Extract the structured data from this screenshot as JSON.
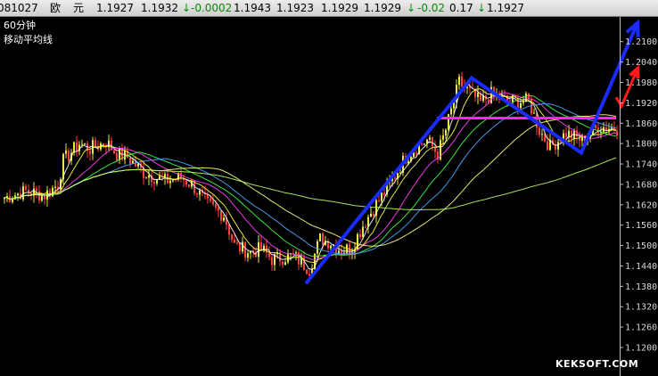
{
  "quote_bar": {
    "code": "081027",
    "name": "欧",
    "name2": "元",
    "price1": "1.1927",
    "price2": "1.1932",
    "change": "-0.0002",
    "open": "1.1943",
    "low": "1.1923",
    "close_a": "1.1929",
    "close_b": "1.1929",
    "change2": "-0.02",
    "value": "0.17",
    "last": "1.1927",
    "arrow_color": "#0a8a0a"
  },
  "chart_data": {
    "type": "line",
    "title": "60分钟",
    "subtitle": "移动平均线",
    "y_ticks": [
      "1.2100",
      "1.2040",
      "1.1980",
      "1.1920",
      "1.1860",
      "1.1800",
      "1.1740",
      "1.1680",
      "1.1620",
      "1.1560",
      "1.1500",
      "1.1440",
      "1.1380",
      "1.1320",
      "1.1260",
      "1.1200"
    ],
    "ylim": [
      1.12,
      1.2115
    ],
    "x_count": 230,
    "anchors": [
      [
        0,
        1.164
      ],
      [
        8,
        1.166
      ],
      [
        15,
        1.1648
      ],
      [
        20,
        1.168
      ],
      [
        22,
        1.175
      ],
      [
        28,
        1.18
      ],
      [
        32,
        1.1785
      ],
      [
        38,
        1.1805
      ],
      [
        42,
        1.177
      ],
      [
        46,
        1.176
      ],
      [
        52,
        1.1715
      ],
      [
        60,
        1.169
      ],
      [
        66,
        1.17
      ],
      [
        70,
        1.168
      ],
      [
        72,
        1.166
      ],
      [
        76,
        1.162
      ],
      [
        82,
        1.159
      ],
      [
        86,
        1.15
      ],
      [
        92,
        1.148
      ],
      [
        96,
        1.149
      ],
      [
        100,
        1.146
      ],
      [
        108,
        1.147
      ],
      [
        114,
        1.143
      ],
      [
        118,
        1.152
      ],
      [
        122,
        1.151
      ],
      [
        126,
        1.1485
      ],
      [
        130,
        1.1495
      ],
      [
        134,
        1.156
      ],
      [
        138,
        1.161
      ],
      [
        144,
        1.168
      ],
      [
        150,
        1.176
      ],
      [
        154,
        1.179
      ],
      [
        158,
        1.181
      ],
      [
        162,
        1.177
      ],
      [
        165,
        1.184
      ],
      [
        170,
        1.198
      ],
      [
        174,
        1.195
      ],
      [
        178,
        1.192
      ],
      [
        182,
        1.1945
      ],
      [
        188,
        1.1925
      ],
      [
        196,
        1.1925
      ],
      [
        200,
        1.184
      ],
      [
        204,
        1.179
      ],
      [
        210,
        1.183
      ],
      [
        216,
        1.181
      ],
      [
        222,
        1.185
      ],
      [
        229,
        1.1845
      ]
    ],
    "ma": [
      {
        "period": 5,
        "color": "#ffffff"
      },
      {
        "period": 10,
        "color": "#ffff40"
      },
      {
        "period": 20,
        "color": "#ff40ff"
      },
      {
        "period": 30,
        "color": "#40ff40"
      },
      {
        "period": 40,
        "color": "#4aa8ff"
      },
      {
        "period": 60,
        "color": "#ffff80"
      },
      {
        "period": 120,
        "color": "#b8ff60"
      }
    ],
    "overlays": {
      "support_level": 1.1875,
      "support_color": "#ff22ff",
      "wave_color": "#1a2bff",
      "wave_points": [
        [
          113,
          1.1388
        ],
        [
          175,
          1.1993
        ],
        [
          216,
          1.1773
        ],
        [
          237,
          1.2155
        ]
      ],
      "arrow_color": "#ff1a1a",
      "arrow_points": [
        [
          229,
          1.1936
        ],
        [
          231,
          1.191
        ],
        [
          237,
          1.202
        ]
      ]
    },
    "candle_up_color": "#e8e840",
    "candle_down_color": "#ff4040",
    "watermark": "KEKSOFT.COM"
  }
}
